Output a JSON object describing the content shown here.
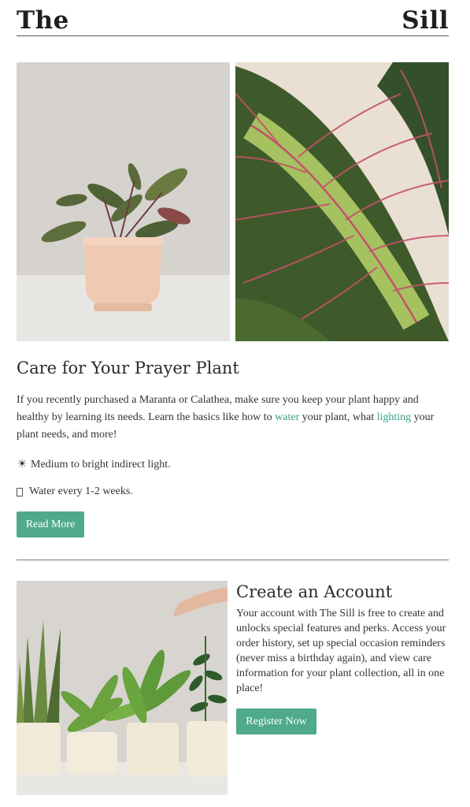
{
  "header": {
    "brand_left": "The",
    "brand_right": "Sill"
  },
  "care": {
    "title": "Care for Your Prayer Plant",
    "para_pre": "If you recently purchased a Maranta or Calathea, make sure you keep your plant happy and healthy by learning its needs. Learn the basics like how to ",
    "link_water": "water",
    "para_mid": " your plant, what ",
    "link_lighting": "lighting",
    "para_post": " your plant needs, and more!",
    "bullet_light": "Medium to bright indirect light.",
    "bullet_water": "Water every 1-2 weeks.",
    "button": "Read More"
  },
  "account": {
    "title": "Create an Account",
    "para": "Your account with The Sill is free to create and unlocks special features and perks. Access your order history, set up special occasion reminders (never miss a birthday again), and view care information for your plant collection, all in one place!",
    "button": "Register Now"
  },
  "colors": {
    "accent": "#4faa8c",
    "link": "#3aa08a",
    "text": "#333333"
  },
  "icons": {
    "light": "sun-icon",
    "water": "water-drop-icon"
  }
}
